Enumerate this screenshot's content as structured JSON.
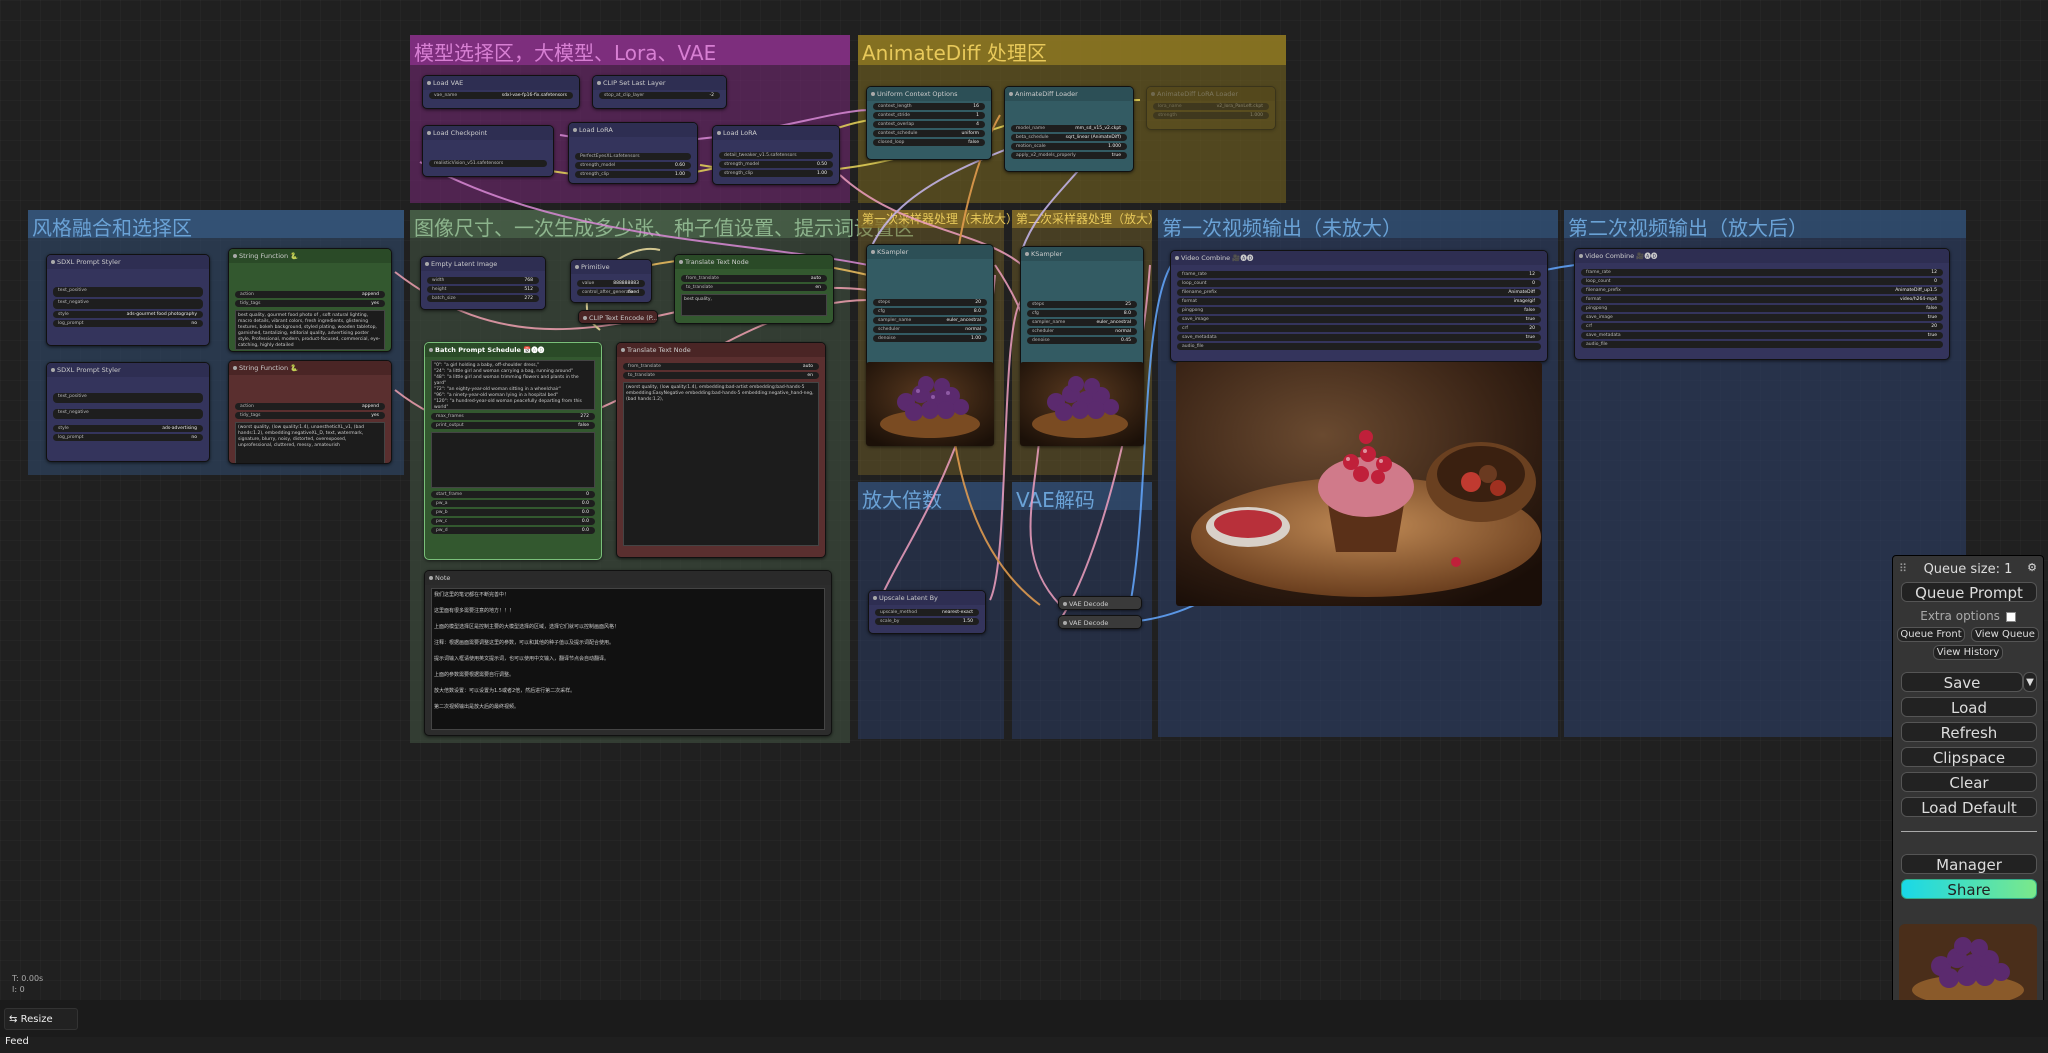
{
  "groups": [
    {
      "title": "模型选择区，大模型、Lora、VAE",
      "color": "#5a2e59"
    },
    {
      "title": "AnimateDiff 处理区",
      "color": "#6e5f1e"
    },
    {
      "title": "风格融合和选择区",
      "color": "#2f4a6b"
    },
    {
      "title": "图像尺寸、一次生成多少张、种子值设置、提示词设置区",
      "color": "#3c5440"
    },
    {
      "title": "第一次采样器处理（未放大）",
      "color": "#6e5a2a"
    },
    {
      "title": "第二次采样器处理（放大）",
      "color": "#6e5a2a"
    },
    {
      "title": "第一次视频输出（未放大）",
      "color": "#2f4a6b"
    },
    {
      "title": "第二次视频输出（放大后）",
      "color": "#2f4a6b"
    },
    {
      "title": "放大倍数",
      "color": "#2f4a6b"
    },
    {
      "title": "VAE解码",
      "color": "#2f4a6b"
    }
  ],
  "nodes": {
    "load_vae": {
      "title": "Load VAE",
      "w1": "vae_name",
      "v1": "sdxl-vae-fp16-fix.safetensors"
    },
    "clip_set_last": {
      "title": "CLIP Set Last Layer",
      "w1": "stop_at_clip_layer",
      "v1": "-2"
    },
    "load_checkpoint": {
      "title": "Load Checkpoint",
      "w1": "ckpt_name",
      "v1": "realisticVision_v51.safetensors"
    },
    "load_lora_1": {
      "title": "Load LoRA",
      "w1": "lora_name",
      "v1": "PerfectEyesXL.safetensors",
      "w2": "strength_model",
      "v2": "0.60",
      "w3": "strength_clip",
      "v3": "1.00"
    },
    "load_lora_2": {
      "title": "Load LoRA",
      "w1": "lora_name",
      "v1": "detail_tweaker_v1.5.safetensors",
      "w2": "strength_model",
      "v2": "0.50",
      "w3": "strength_clip",
      "v3": "1.00"
    },
    "uniform_context": {
      "title": "Uniform Context Options",
      "w1": "context_length",
      "v1": "16",
      "w2": "context_stride",
      "v2": "1",
      "w3": "context_overlap",
      "v3": "4",
      "w4": "context_schedule",
      "v4": "uniform",
      "w5": "closed_loop",
      "v5": "false"
    },
    "animatediff_loader": {
      "title": "AnimateDiff Loader",
      "w1": "model_name",
      "v1": "mm_sd_v15_v2.ckpt",
      "w2": "beta_schedule",
      "v2": "sqrt_linear (AnimateDiff)",
      "w3": "motion_scale",
      "v3": "1.000",
      "w4": "apply_v2_models_properly",
      "v4": "true"
    },
    "animatediff_lora": {
      "title": "AnimateDiff LoRA Loader",
      "w1": "lora_name",
      "v1": "v2_lora_PanLeft.ckpt",
      "w2": "strength",
      "v2": "1.000"
    },
    "sdxl_styler_1": {
      "title": "SDXL Prompt Styler",
      "w1": "text_positive",
      "w2": "text_negative",
      "w3": "style",
      "v3": "ads-gourmet food photography",
      "w4": "log_prompt",
      "v4": "no"
    },
    "sdxl_styler_2": {
      "title": "SDXL Prompt Styler",
      "w1": "text_positive",
      "w2": "text_negative",
      "w3": "style",
      "v3": "ads-advertising",
      "w4": "log_prompt",
      "v4": "no"
    },
    "string_fn_1": {
      "title": "String Function 🐍",
      "w1": "action",
      "v1": "append",
      "w2": "tidy_tags",
      "v2": "yes",
      "text": "best quality, gourmet food photo of , soft natural lighting, macro details, vibrant colors, fresh ingredients, glistening textures, bokeh background, styled plating, wooden tabletop, garnished, tantalizing, editorial quality, advertising poster style, Professional, modern, product-focused, commercial, eye-catching, highly detailed"
    },
    "string_fn_2": {
      "title": "String Function 🐍",
      "w1": "action",
      "v1": "append",
      "w2": "tidy_tags",
      "v2": "yes",
      "text": "(worst quality, (low quality:1.4), unaestheticXL_v1, (bad hands:1.2), embedding:negativeXL_D, text, watermark, signature, blurry, noisy, distorted, overexposed, unprofessional, cluttered, messy, amateurish"
    },
    "empty_latent": {
      "title": "Empty Latent Image",
      "w1": "width",
      "v1": "768",
      "w2": "height",
      "v2": "512",
      "w3": "batch_size",
      "v3": "272"
    },
    "primitive": {
      "title": "Primitive",
      "w1": "value",
      "v1": "888888883",
      "w2": "control_after_generate",
      "v2": "fixed"
    },
    "clip_text_encode": {
      "title": "CLIP Text Encode (P..."
    },
    "translate_1": {
      "title": "Translate Text Node",
      "w1": "from_translate",
      "v1": "auto",
      "w2": "to_translate",
      "v2": "en",
      "text": "best quality,"
    },
    "batch_prompt": {
      "title": "Batch Prompt Schedule 📅🅐🅓",
      "text": "\"0\": \"a girl holding a baby, off-shoulder dress,\"\n\"24\": \"a little girl and woman carrying a bag, running around\"\n\"48\": \"a little girl and woman trimming flowers and plants in the yard\"\n\"72\": \"an eighty-year-old woman sitting in a wheelchair\"\n\"96\": \"a ninety-year-old woman lying in a hospital bed\"\n\"120\": \"a hundred-year-old woman peacefully departing from this world\"",
      "w1": "max_frames",
      "v1": "272",
      "w2": "print_output",
      "v2": "false",
      "w3": "start_frame",
      "v3": "0",
      "w4": "pw_a",
      "v4": "0.0",
      "w5": "pw_b",
      "v5": "0.0",
      "w6": "pw_c",
      "v6": "0.0",
      "w7": "pw_d",
      "v7": "0.0"
    },
    "translate_2": {
      "title": "Translate Text Node",
      "w1": "from_translate",
      "v1": "auto",
      "w2": "to_translate",
      "v2": "en",
      "text": "(worst quality, (low quality:1.4), embedding:bad-artist embedding:bad-hands-5 embedding:EasyNegative embedding:bad-hands-5 embedding:negative_hand-neg, (bad hands:1.2),"
    },
    "note": {
      "title": "Note",
      "text": "我们这里的笔记都在不断完善中！\n\n这里面有很多需要注意的地方！！！\n\n上面的模型选择区是控制主要的大模型选择的区域，选择它们就可以控制画面风格！\n\n注释：根据画面需要调整这里的参数，可以和其他的种子值以及提示词配合使用。\n\n提示词输入框请使用英文提示词，也可以使用中文输入，翻译节点会自动翻译。\n\n上面的参数需要根据需要自行调整。\n\n放大倍数设置：可以设置为1.5或者2倍，然后进行第二次采样。\n\n第二次视频输出是放大后的最终视频。"
    },
    "ksampler_1": {
      "title": "KSampler",
      "w1": "steps",
      "v1": "20",
      "w2": "cfg",
      "v2": "8.0",
      "w3": "sampler_name",
      "v3": "euler_ancestral",
      "w4": "scheduler",
      "v4": "normal",
      "w5": "denoise",
      "v5": "1.00"
    },
    "ksampler_2": {
      "title": "KSampler",
      "w1": "steps",
      "v1": "25",
      "w2": "cfg",
      "v2": "8.0",
      "w3": "sampler_name",
      "v3": "euler_ancestral",
      "w4": "scheduler",
      "v4": "normal",
      "w5": "denoise",
      "v5": "0.45"
    },
    "video_combine_1": {
      "title": "Video Combine 🎥🅐🅓",
      "w1": "frame_rate",
      "v1": "12",
      "w2": "loop_count",
      "v2": "0",
      "w3": "filename_prefix",
      "v3": "AnimateDiff",
      "w4": "format",
      "v4": "image/gif",
      "w5": "pingpong",
      "v5": "false",
      "w6": "save_image",
      "v6": "true",
      "w7": "crf",
      "v7": "20",
      "w8": "save_metadata",
      "v8": "true",
      "w9": "audio_file"
    },
    "video_combine_2": {
      "title": "Video Combine 🎥🅐🅓",
      "w1": "frame_rate",
      "v1": "12",
      "w2": "loop_count",
      "v2": "0",
      "w3": "filename_prefix",
      "v3": "AnimateDiff_up1.5",
      "w4": "format",
      "v4": "video/h264-mp4",
      "w5": "pingpong",
      "v5": "false",
      "w6": "save_image",
      "v6": "true",
      "w7": "crf",
      "v7": "20",
      "w8": "save_metadata",
      "v8": "true",
      "w9": "audio_file"
    },
    "upscale_latent": {
      "title": "Upscale Latent By",
      "w1": "upscale_method",
      "v1": "nearest-exact",
      "w2": "scale_by",
      "v2": "1.50"
    },
    "vae_decode_1": {
      "title": "VAE Decode"
    },
    "vae_decode_2": {
      "title": "VAE Decode"
    }
  },
  "panel": {
    "queue_size": "Queue size: 1",
    "queue_prompt": "Queue Prompt",
    "extra_options": "Extra options",
    "queue_front": "Queue Front",
    "view_queue": "View Queue",
    "view_history": "View History",
    "save": "Save",
    "load": "Load",
    "refresh": "Refresh",
    "clipspace": "Clipspace",
    "clear": "Clear",
    "load_default": "Load Default",
    "manager": "Manager",
    "share": "Share",
    "share_color_start": "#19d8e8",
    "share_color_end": "#7be88a"
  },
  "stats": {
    "time": "T: 0.00s",
    "nodes": "I: 0"
  },
  "resize_feed": "Resize Feed",
  "icons": {
    "gear": "gear-icon",
    "drag": "drag-handle-icon",
    "dropdown": "chevron-down-icon",
    "resize": "resize-icon"
  }
}
